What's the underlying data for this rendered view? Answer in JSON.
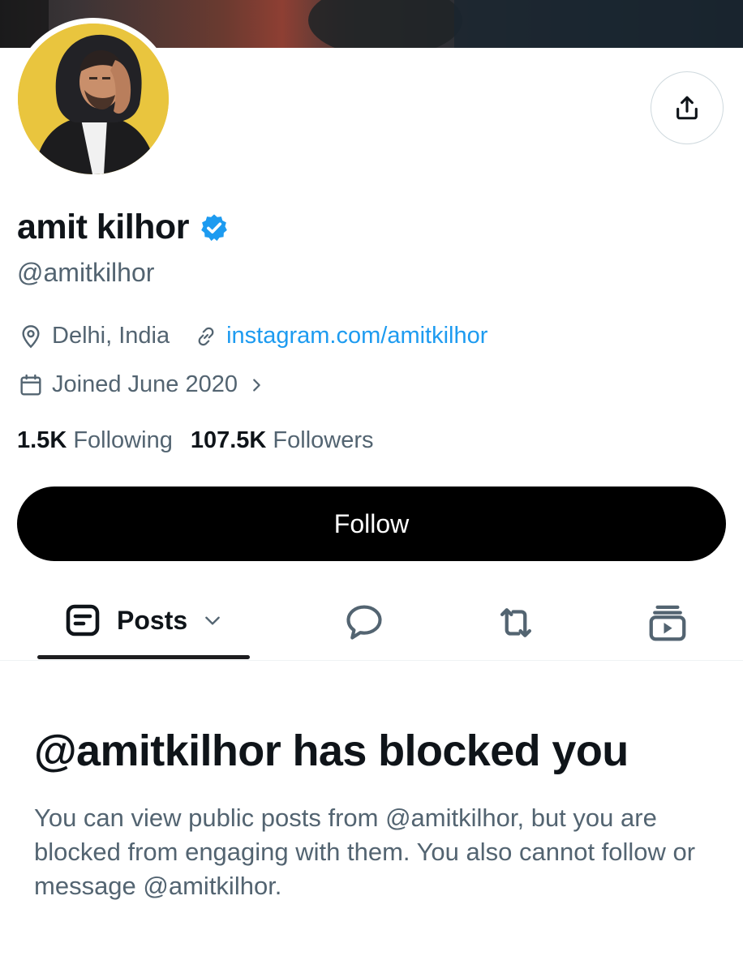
{
  "profile": {
    "display_name": "amit kilhor",
    "handle": "@amitkilhor",
    "location": "Delhi, India",
    "website": "instagram.com/amitkilhor",
    "joined": "Joined June 2020",
    "following_count": "1.5K",
    "following_label": "Following",
    "followers_count": "107.5K",
    "followers_label": "Followers",
    "verified": true
  },
  "actions": {
    "follow_label": "Follow",
    "share_icon": "share-icon"
  },
  "tabs": {
    "posts_label": "Posts",
    "icons": [
      "posts-icon",
      "chevron-down-icon",
      "replies-icon",
      "reposts-icon",
      "media-icon"
    ]
  },
  "blocked": {
    "title": "@amitkilhor has blocked you",
    "description": "You can view public posts from @amitkilhor, but you are blocked from engaging with them. You also cannot follow or message @amitkilhor."
  },
  "colors": {
    "accent": "#1d9bf0",
    "muted_text": "#536471",
    "primary_text": "#0f1419",
    "avatar_bg": "#e9c53e"
  }
}
